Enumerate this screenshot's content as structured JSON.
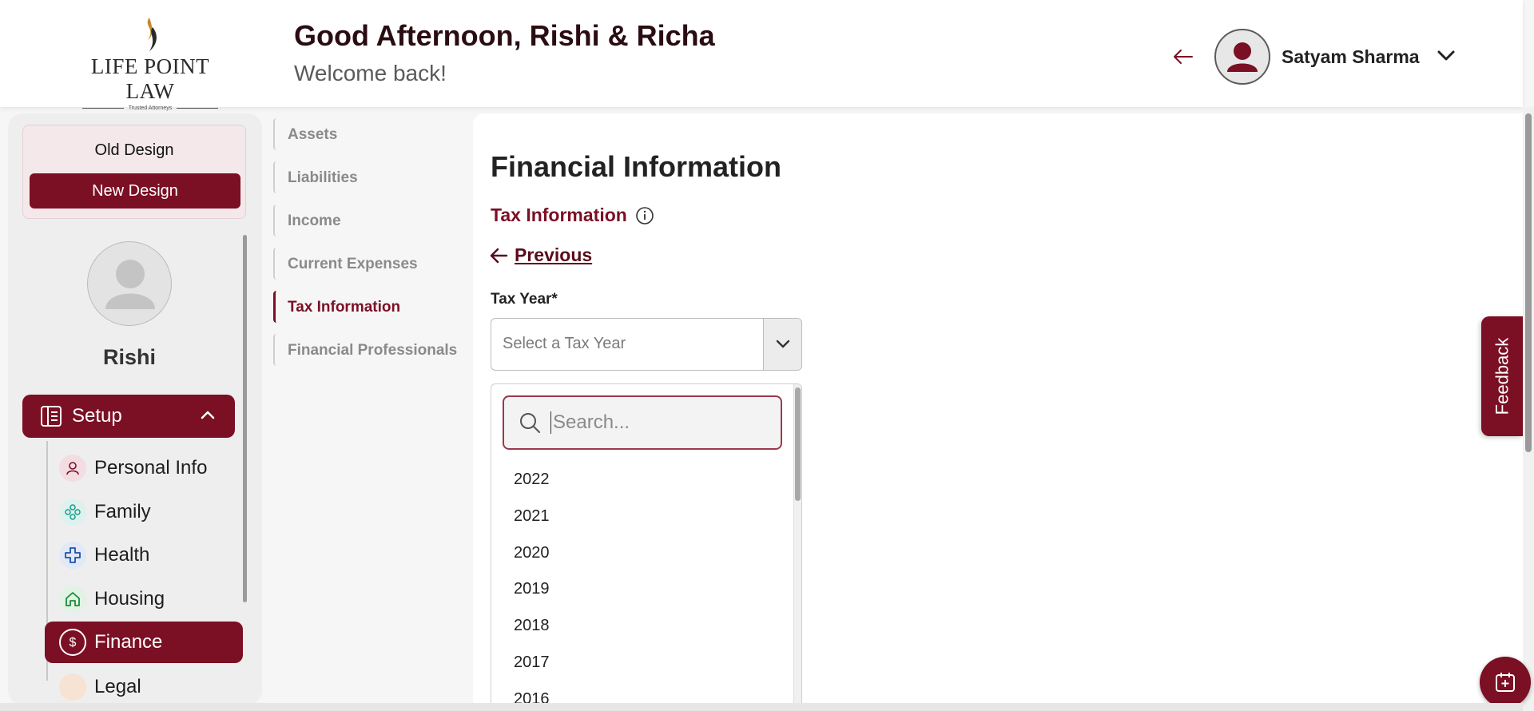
{
  "brand": {
    "name": "LIFE POINT LAW",
    "tagline": "Trusted Attorneys"
  },
  "header": {
    "greeting": "Good Afternoon, Rishi & Richa",
    "subgreeting": "Welcome back!",
    "user_name": "Satyam Sharma"
  },
  "design_toggle": {
    "old": "Old Design",
    "new": "New Design",
    "active": "New Design"
  },
  "profile": {
    "name": "Rishi"
  },
  "sidebar": {
    "section": "Setup",
    "items": [
      {
        "label": "Personal Info",
        "icon": "person-icon",
        "color": "#7b0f24",
        "active": false
      },
      {
        "label": "Family",
        "icon": "family-icon",
        "color": "#1a9a8a",
        "active": false
      },
      {
        "label": "Health",
        "icon": "health-cross-icon",
        "color": "#1f4fa8",
        "active": false
      },
      {
        "label": "Housing",
        "icon": "home-icon",
        "color": "#1f8a3a",
        "active": false
      },
      {
        "label": "Finance",
        "icon": "dollar-icon",
        "color": "#ffffff",
        "active": true
      },
      {
        "label": "Legal",
        "icon": "legal-icon",
        "color": "#c56a2a",
        "active": false
      }
    ]
  },
  "subnav": {
    "items": [
      {
        "label": "Assets",
        "active": false
      },
      {
        "label": "Liabilities",
        "active": false
      },
      {
        "label": "Income",
        "active": false
      },
      {
        "label": "Current Expenses",
        "active": false
      },
      {
        "label": "Tax Information",
        "active": true
      },
      {
        "label": "Financial Professionals",
        "active": false
      }
    ]
  },
  "main": {
    "title": "Financial Information",
    "section": "Tax Information",
    "previous": "Previous",
    "field_label": "Tax Year*",
    "select_placeholder": "Select a Tax Year",
    "search_placeholder": "Search...",
    "options": [
      "2022",
      "2021",
      "2020",
      "2019",
      "2018",
      "2017",
      "2016"
    ]
  },
  "feedback": "Feedback",
  "colors": {
    "accent": "#7b0f24",
    "accent_dark": "#5a0c1a"
  }
}
